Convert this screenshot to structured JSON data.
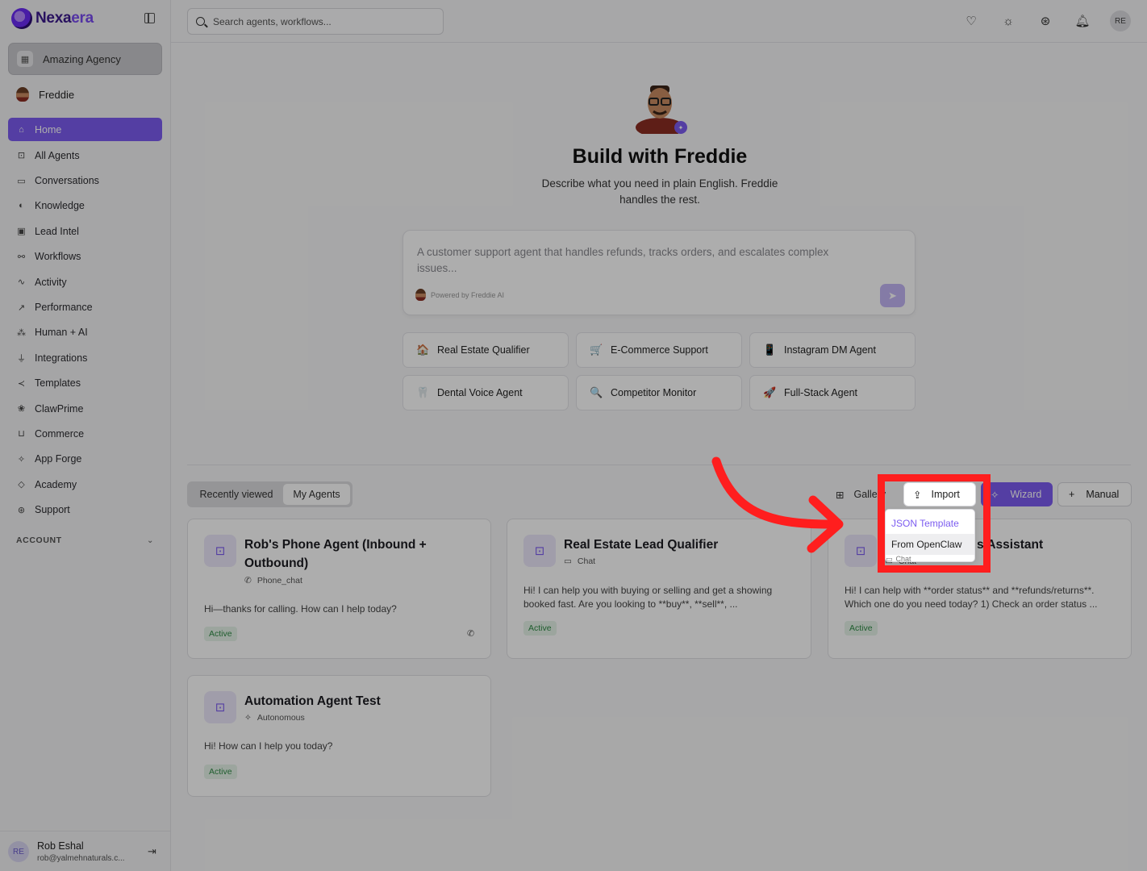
{
  "sidebar": {
    "brand": {
      "name_main": "Nexa",
      "name_accent": "era"
    },
    "agency": "Amazing Agency",
    "builder": "Freddie",
    "items": [
      {
        "label": "Home",
        "icon": "home-icon"
      },
      {
        "label": "All Agents",
        "icon": "bot-icon"
      },
      {
        "label": "Conversations",
        "icon": "chat-icon"
      },
      {
        "label": "Knowledge",
        "icon": "brain-icon"
      },
      {
        "label": "Lead Intel",
        "icon": "contact-icon"
      },
      {
        "label": "Workflows",
        "icon": "workflow-icon"
      },
      {
        "label": "Activity",
        "icon": "pulse-icon"
      },
      {
        "label": "Performance",
        "icon": "trend-icon"
      },
      {
        "label": "Human + AI",
        "icon": "network-icon"
      },
      {
        "label": "Integrations",
        "icon": "plug-icon"
      },
      {
        "label": "Templates",
        "icon": "share-icon"
      },
      {
        "label": "ClawPrime",
        "icon": "paw-icon"
      },
      {
        "label": "Commerce",
        "icon": "cart-icon"
      },
      {
        "label": "App Forge",
        "icon": "sparkle-icon"
      },
      {
        "label": "Academy",
        "icon": "graduation-icon"
      },
      {
        "label": "Support",
        "icon": "lifebuoy-icon"
      }
    ],
    "account_label": "ACCOUNT",
    "user": {
      "initials": "RE",
      "name": "Rob Eshal",
      "email": "rob@yalmehnaturals.c..."
    }
  },
  "topbar": {
    "search_placeholder": "Search agents, workflows...",
    "icons": [
      "heart-icon",
      "sun-icon",
      "lifebuoy-icon",
      "bell-icon"
    ],
    "avatar_initials": "RE"
  },
  "hero": {
    "title": "Build with Freddie",
    "subtitle": "Describe what you need in plain English. Freddie handles the rest.",
    "prompt_placeholder": "A customer support agent that handles refunds, tracks orders, and escalates complex issues...",
    "powered_by": "Powered by Freddie AI"
  },
  "quick_templates": [
    {
      "label": "Real Estate Qualifier",
      "icon": "🏠"
    },
    {
      "label": "E-Commerce Support",
      "icon": "🛒"
    },
    {
      "label": "Instagram DM Agent",
      "icon": "📱"
    },
    {
      "label": "Dental Voice Agent",
      "icon": "🦷"
    },
    {
      "label": "Competitor Monitor",
      "icon": "🔍"
    },
    {
      "label": "Full-Stack Agent",
      "icon": "🚀"
    }
  ],
  "toolbar": {
    "tab_recent": "Recently viewed",
    "tab_mine": "My Agents",
    "gallery": "Gallery",
    "import": "Import",
    "wizard": "Wizard",
    "manual": "Manual"
  },
  "import_menu": {
    "items": [
      "JSON Template",
      "From OpenClaw"
    ],
    "peek": "Chat"
  },
  "agents": [
    {
      "title": "Rob's Phone Agent (Inbound + Outbound)",
      "type": "Phone_chat",
      "desc": "Hi—thanks for calling. How can I help today?",
      "status": "Active"
    },
    {
      "title": "Real Estate Lead Qualifier",
      "type": "Chat",
      "desc": "Hi! I can help you with buying or selling and get a showing booked fast. Are you looking to **buy**, **sell**, ...",
      "status": "Active"
    },
    {
      "title": "s Assistant",
      "type": "Chat",
      "desc": "Hi! I can help with **order status** and **refunds/returns**. Which one do you need today? 1) Check an order status ...",
      "status": "Active"
    },
    {
      "title": "Automation Agent Test",
      "type": "Autonomous",
      "desc": "Hi! How can I help you today?",
      "status": "Active"
    }
  ],
  "colors": {
    "accent": "#7c5cf0",
    "highlight": "#ff1e1e",
    "active_badge": "#2f8a45"
  }
}
